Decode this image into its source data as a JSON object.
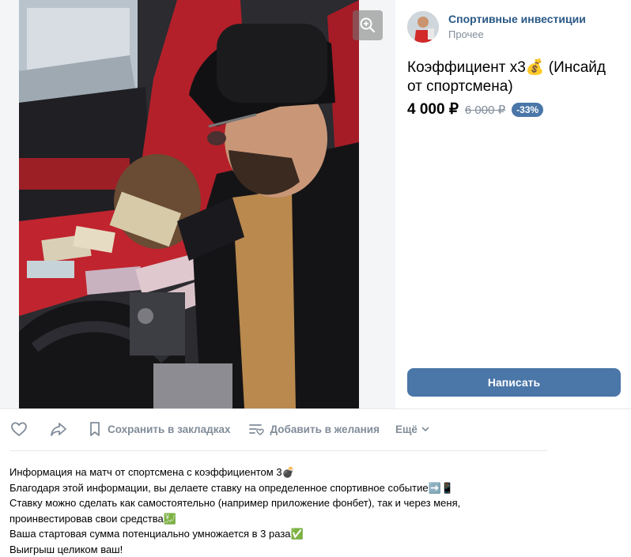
{
  "seller": {
    "name": "Спортивные инвестиции",
    "category": "Прочее"
  },
  "product": {
    "title": "Коэффициент x3💰 (Инсайд от спортсмена)",
    "price": "4 000 ₽",
    "old_price": "6 000 ₽",
    "discount": "-33%"
  },
  "buttons": {
    "write": "Написать",
    "bookmark": "Сохранить в закладках",
    "wishlist": "Добавить в желания",
    "more": "Ещё"
  },
  "description": [
    "Информация на матч от спортсмена с коэффициентом 3💣",
    "Благодаря этой информации, вы делаете ставку на определенное спортивное событие➡️📱",
    "Ставку можно сделать как самостоятельно (например приложение фонбет), так и через меня,",
    "проинвестировав свои средства💹",
    "Ваша стартовая сумма потенциально умножается в 3 раза✅",
    "Выигрыш целиком ваш!"
  ],
  "icons": {
    "zoom": "zoom-in-icon",
    "like": "heart-icon",
    "share": "share-arrow-icon",
    "bookmark": "bookmark-icon",
    "wishlist": "wishlist-icon",
    "more": "chevron-down-icon"
  },
  "colors": {
    "accent": "#4a76a8",
    "link": "#2a5885",
    "secondary_text": "#818c99"
  }
}
